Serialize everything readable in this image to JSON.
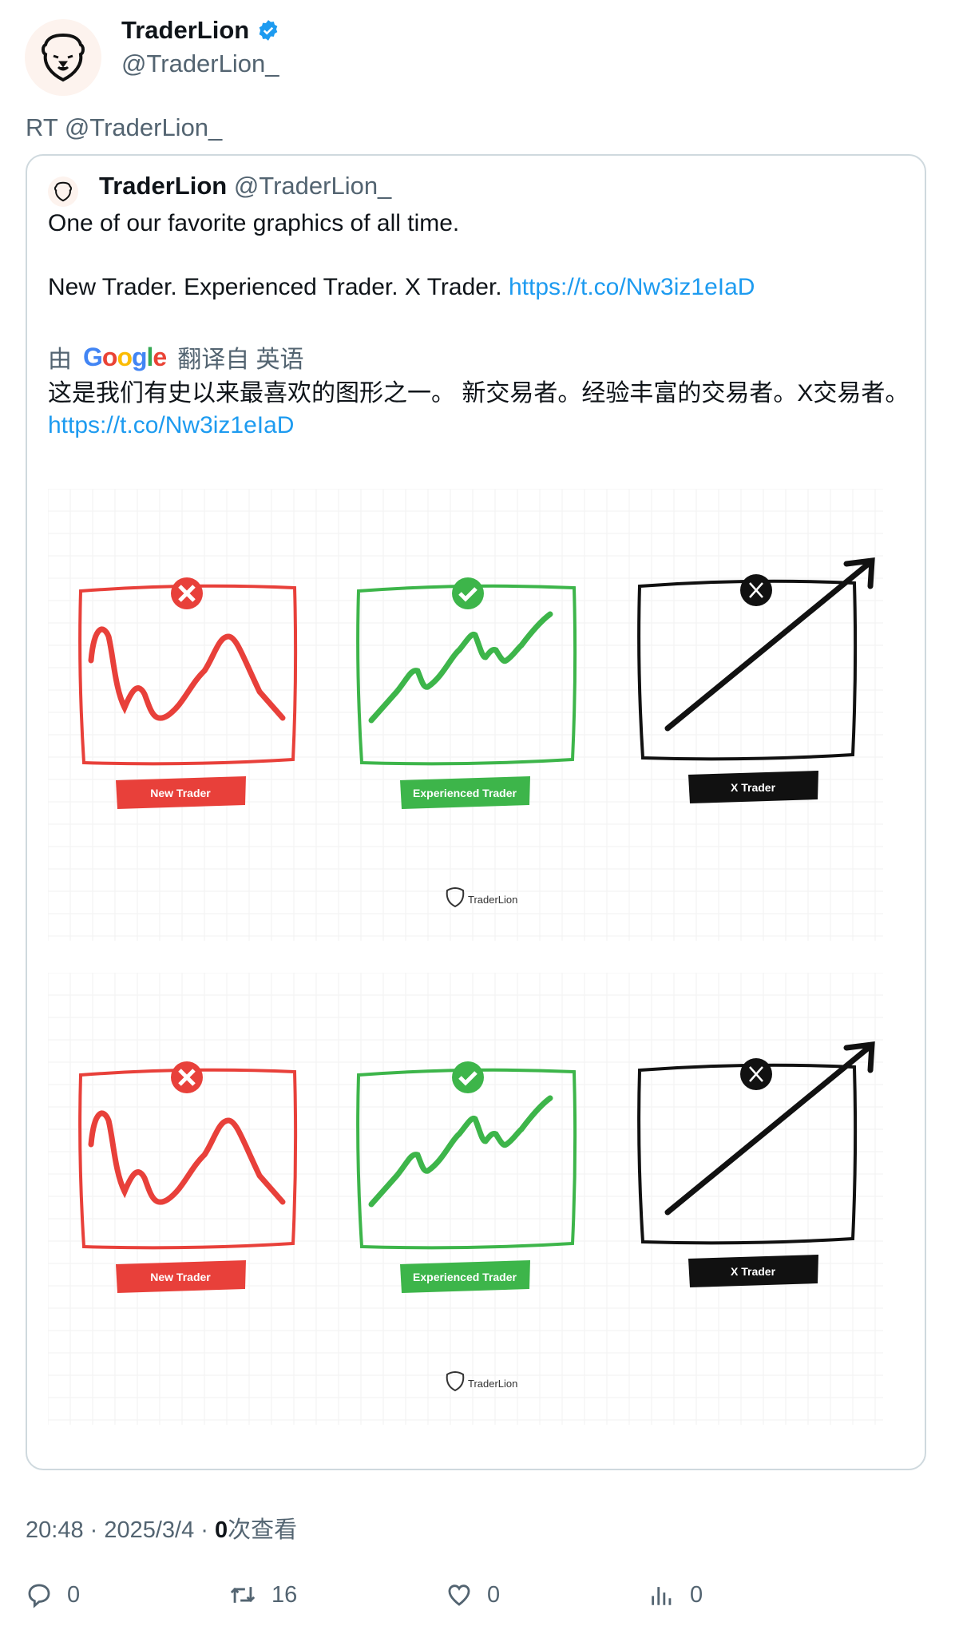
{
  "author": {
    "name": "TraderLion",
    "handle": "@TraderLion_",
    "verified": true
  },
  "retweet_label": "RT @TraderLion_",
  "quoted": {
    "name": "TraderLion",
    "handle": "@TraderLion_",
    "line1": "One of our favorite graphics of all time.",
    "line2": "New Trader. Experienced Trader. X Trader.",
    "link": "https://t.co/Nw3iz1eIaD",
    "translation": {
      "prefix": "由",
      "provider": "Google",
      "suffix": "翻译自 英语",
      "text": "这是我们有史以来最喜欢的图形之一。 新交易者。经验丰富的交易者。X交易者。",
      "link": "https://t.co/Nw3iz1eIaD"
    },
    "graphic": {
      "labels": [
        "New Trader",
        "Experienced Trader",
        "X Trader"
      ],
      "watermark": "TraderLion",
      "colors": {
        "new": "#e8403a",
        "experienced": "#3db54a",
        "x": "#111111"
      }
    }
  },
  "meta": {
    "time": "20:48",
    "date": "2025/3/4",
    "views": "0",
    "views_label": "次查看"
  },
  "actions": [
    {
      "icon": "reply-icon",
      "count": "0"
    },
    {
      "icon": "retweet-icon",
      "count": "16"
    },
    {
      "icon": "like-icon",
      "count": "0"
    },
    {
      "icon": "views-icon",
      "count": "0"
    }
  ],
  "colors": {
    "text": "#0f1419",
    "muted": "#536471",
    "link": "#1d9bf0",
    "verified": "#1d9bf0"
  }
}
